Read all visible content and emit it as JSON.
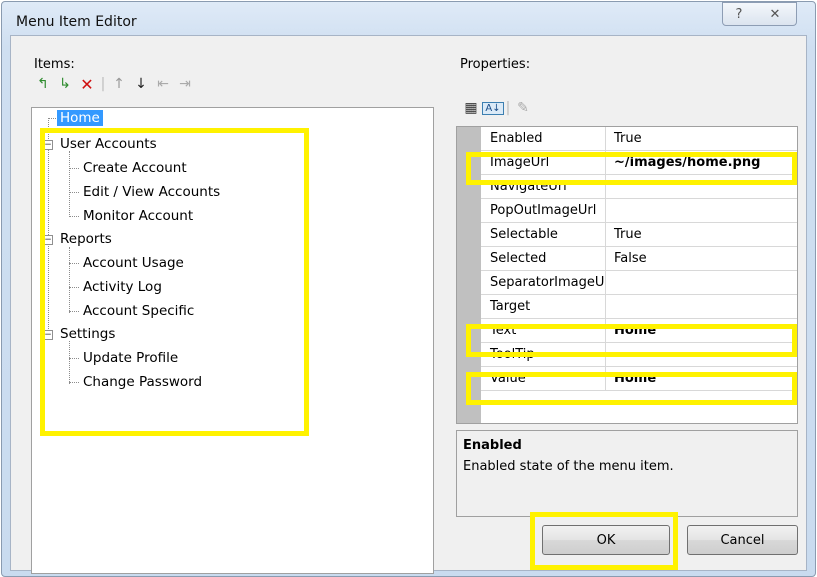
{
  "window": {
    "title": "Menu Item Editor",
    "help_glyph": "?",
    "close_glyph": "✕"
  },
  "items_label": "Items:",
  "properties_label": "Properties:",
  "items_toolbar": {
    "add_root": "↰",
    "add_child": "↳",
    "delete": "✕",
    "move_up": "↑",
    "move_down": "↓",
    "indent": "⇤",
    "outdent": "⇥"
  },
  "tree": {
    "home": "Home",
    "user_accounts": "User Accounts",
    "create_account": "Create Account",
    "edit_view_accounts": "Edit / View Accounts",
    "monitor_account": "Monitor Account",
    "reports": "Reports",
    "account_usage": "Account Usage",
    "activity_log": "Activity Log",
    "account_specific": "Account Specific",
    "settings": "Settings",
    "update_profile": "Update Profile",
    "change_password": "Change Password",
    "expander_glyph": "−"
  },
  "props_toolbar": {
    "categorized": "▦",
    "alphabetical": "A↓",
    "property_pages": "✎"
  },
  "properties": [
    {
      "name": "Enabled",
      "value": "True"
    },
    {
      "name": "ImageUrl",
      "value": "~/images/home.png"
    },
    {
      "name": "NavigateUrl",
      "value": ""
    },
    {
      "name": "PopOutImageUrl",
      "value": ""
    },
    {
      "name": "Selectable",
      "value": "True"
    },
    {
      "name": "Selected",
      "value": "False"
    },
    {
      "name": "SeparatorImageUrl",
      "value": ""
    },
    {
      "name": "Target",
      "value": ""
    },
    {
      "name": "Text",
      "value": "Home"
    },
    {
      "name": "ToolTip",
      "value": ""
    },
    {
      "name": "Value",
      "value": "Home"
    }
  ],
  "description": {
    "title": "Enabled",
    "text": "Enabled state of the menu item."
  },
  "buttons": {
    "ok": "OK",
    "cancel": "Cancel"
  },
  "colors": {
    "highlight": "#fff200",
    "selection": "#3399ff"
  }
}
